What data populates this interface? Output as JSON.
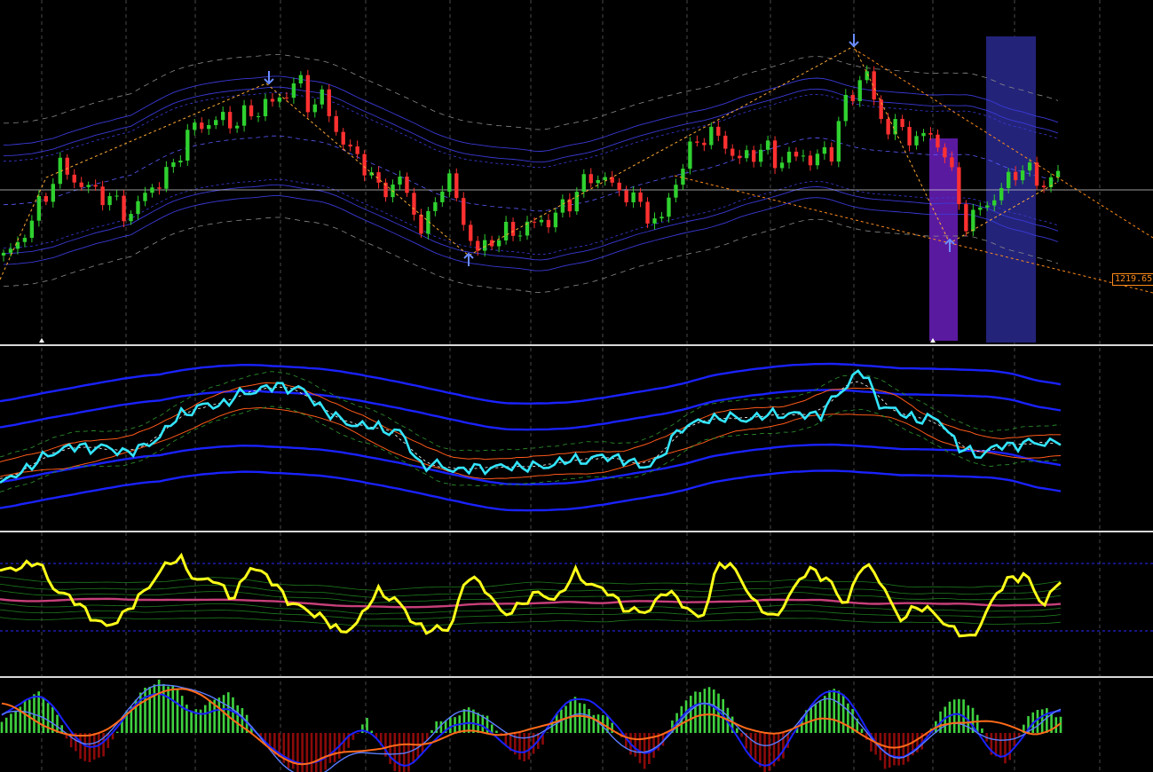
{
  "chart_data": [
    {
      "type": "candlestick",
      "panel": "price",
      "y_marker_label": "1219.65",
      "colors": {
        "bull": "#2fd12f",
        "bear": "#ff3030",
        "band": "#3a3ad8",
        "grid": "#bfbfbf",
        "zigzag": "#ffaa33",
        "trend": "#ff8c1a",
        "box_purple": "#5a1aa0",
        "box_blue": "#23237a",
        "fractal": "#6a8cff"
      },
      "close": [
        0.25,
        0.27,
        0.35,
        0.44,
        0.5,
        0.57,
        0.55,
        0.52,
        0.49,
        0.46,
        0.45,
        0.41,
        0.44,
        0.5,
        0.54,
        0.6,
        0.67,
        0.73,
        0.75,
        0.77,
        0.73,
        0.76,
        0.79,
        0.82,
        0.8,
        0.86,
        0.92,
        0.8,
        0.83,
        0.75,
        0.68,
        0.62,
        0.57,
        0.5,
        0.52,
        0.53,
        0.42,
        0.35,
        0.45,
        0.56,
        0.44,
        0.34,
        0.27,
        0.3,
        0.33,
        0.35,
        0.37,
        0.36,
        0.38,
        0.43,
        0.46,
        0.51,
        0.53,
        0.57,
        0.48,
        0.48,
        0.44,
        0.41,
        0.38,
        0.48,
        0.61,
        0.68,
        0.7,
        0.68,
        0.65,
        0.62,
        0.61,
        0.66,
        0.6,
        0.64,
        0.6,
        0.61,
        0.63,
        0.64,
        0.8,
        0.83,
        0.99,
        0.76,
        0.73,
        0.72,
        0.7,
        0.7,
        0.67,
        0.64,
        0.5,
        0.36,
        0.41,
        0.46,
        0.51,
        0.55,
        0.57,
        0.54,
        0.53,
        0.55
      ]
    },
    {
      "type": "line",
      "panel": "oscillator-1",
      "series": [
        {
          "color": "#33e6ff",
          "values": [
            0.18,
            0.27,
            0.35,
            0.43,
            0.44,
            0.44,
            0.41,
            0.42,
            0.52,
            0.66,
            0.72,
            0.73,
            0.8,
            0.84,
            0.86,
            0.84,
            0.72,
            0.62,
            0.59,
            0.57,
            0.54,
            0.32,
            0.31,
            0.28,
            0.3,
            0.3,
            0.31,
            0.3,
            0.34,
            0.35,
            0.37,
            0.37,
            0.3,
            0.36,
            0.58,
            0.61,
            0.65,
            0.63,
            0.65,
            0.67,
            0.66,
            0.67,
            0.82,
            0.98,
            0.73,
            0.67,
            0.63,
            0.63,
            0.42,
            0.39,
            0.45,
            0.46,
            0.47,
            0.48
          ]
        }
      ]
    },
    {
      "type": "line",
      "panel": "oscillator-2",
      "series": [
        {
          "color": "#ffff1a",
          "values": [
            0.78,
            0.82,
            0.88,
            0.65,
            0.55,
            0.42,
            0.3,
            0.45,
            0.6,
            0.82,
            0.9,
            0.7,
            0.72,
            0.55,
            0.85,
            0.72,
            0.55,
            0.45,
            0.4,
            0.25,
            0.38,
            0.62,
            0.55,
            0.35,
            0.28,
            0.3,
            0.75,
            0.65,
            0.4,
            0.52,
            0.6,
            0.55,
            0.78,
            0.66,
            0.6,
            0.44,
            0.45,
            0.62,
            0.52,
            0.35,
            0.88,
            0.78,
            0.52,
            0.38,
            0.6,
            0.82,
            0.72,
            0.5,
            0.85,
            0.72,
            0.36,
            0.5,
            0.42,
            0.3,
            0.2,
            0.48,
            0.72,
            0.76,
            0.5,
            0.72
          ]
        }
      ]
    },
    {
      "type": "bar",
      "panel": "histogram",
      "values": [
        0.2,
        0.5,
        0.8,
        0.5,
        -0.3,
        -0.6,
        -0.4,
        0.3,
        0.8,
        1,
        0.9,
        0.4,
        0.6,
        0.8,
        0.4,
        -0.2,
        -0.5,
        -0.8,
        -0.9,
        -0.6,
        -0.3,
        0.3,
        -0.4,
        -0.9,
        -0.5,
        0.2,
        0.3,
        0.5,
        0.3,
        -0.2,
        -0.6,
        -0.3,
        0.4,
        0.7,
        0.4,
        0.3,
        -0.3,
        -0.7,
        -0.3,
        0.5,
        0.8,
        0.9,
        0.4,
        -0.4,
        -0.8,
        -0.5,
        0.3,
        0.6,
        0.9,
        0.5,
        -0.3,
        -0.7,
        -0.6,
        -0.3,
        0.4,
        0.7,
        0.5,
        -0.4,
        -0.6,
        0.3,
        0.5,
        0.3
      ]
    }
  ]
}
